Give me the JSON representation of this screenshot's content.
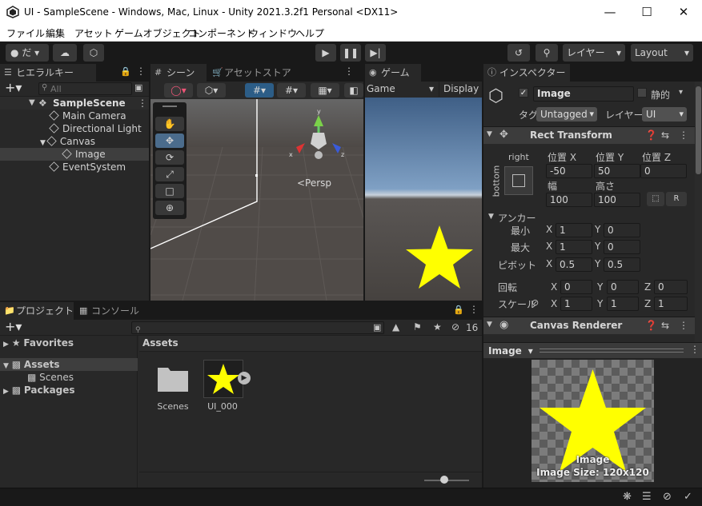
{
  "window": {
    "title": "UI - SampleScene - Windows, Mac, Linux - Unity 2021.3.2f1 Personal <DX11>"
  },
  "menu": [
    "ファイル",
    "編集",
    "アセット",
    "ゲームオブジェクト",
    "コンポーネント",
    "ウィンドウ",
    "ヘルプ"
  ],
  "toolbar": {
    "account": "だ",
    "layers": "レイヤー",
    "layout": "Layout"
  },
  "hierarchy": {
    "tab": "ヒエラルキー",
    "search_placeholder": "All",
    "scene": "SampleScene",
    "items": [
      "Main Camera",
      "Directional Light",
      "Canvas",
      "Image",
      "EventSystem"
    ]
  },
  "scene_view": {
    "tab_scene": "シーン",
    "tab_store": "アセットストア",
    "persp": "<Persp",
    "gizmo_y": "y",
    "gizmo_x": "x",
    "gizmo_z": "z"
  },
  "game_view": {
    "tab": "ゲーム",
    "display_mode": "Game",
    "display": "Display"
  },
  "inspector": {
    "tab": "インスペクター",
    "object_name": "Image",
    "static_label": "静的",
    "tag_label": "タグ",
    "tag_value": "Untagged",
    "layer_label": "レイヤー",
    "layer_value": "UI",
    "rect_transform": {
      "title": "Rect Transform",
      "anchor_h": "right",
      "anchor_v": "bottom",
      "pos_x_label": "位置 X",
      "pos_y_label": "位置 Y",
      "pos_z_label": "位置 Z",
      "pos_x": "-50",
      "pos_y": "50",
      "pos_z": "0",
      "width_label": "幅",
      "height_label": "高さ",
      "width": "100",
      "height": "100",
      "r_button": "R",
      "anchors_label": "アンカー",
      "min_label": "最小",
      "max_label": "最大",
      "pivot_label": "ピボット",
      "min_x": "1",
      "min_y": "0",
      "max_x": "1",
      "max_y": "0",
      "pivot_x": "0.5",
      "pivot_y": "0.5",
      "rotation_label": "回転",
      "scale_label": "スケール",
      "rot_x": "0",
      "rot_y": "0",
      "rot_z": "0",
      "scale_x": "1",
      "scale_y": "1",
      "scale_z": "1",
      "x_letter": "X",
      "y_letter": "Y",
      "z_letter": "Z"
    },
    "canvas_renderer": {
      "title": "Canvas Renderer"
    },
    "preview": {
      "dropdown": "Image",
      "caption": "Image",
      "size": "Image Size: 120x120"
    }
  },
  "project": {
    "tab_project": "プロジェクト",
    "tab_console": "コンソール",
    "favorites": "Favorites",
    "assets": "Assets",
    "scenes": "Scenes",
    "packages": "Packages",
    "breadcrumb": "Assets",
    "hidden_count": "16",
    "grid_items": [
      "Scenes",
      "UI_000"
    ]
  },
  "colors": {
    "accent": "#2c5d87",
    "star": "#ffff00",
    "panel": "#282828"
  }
}
